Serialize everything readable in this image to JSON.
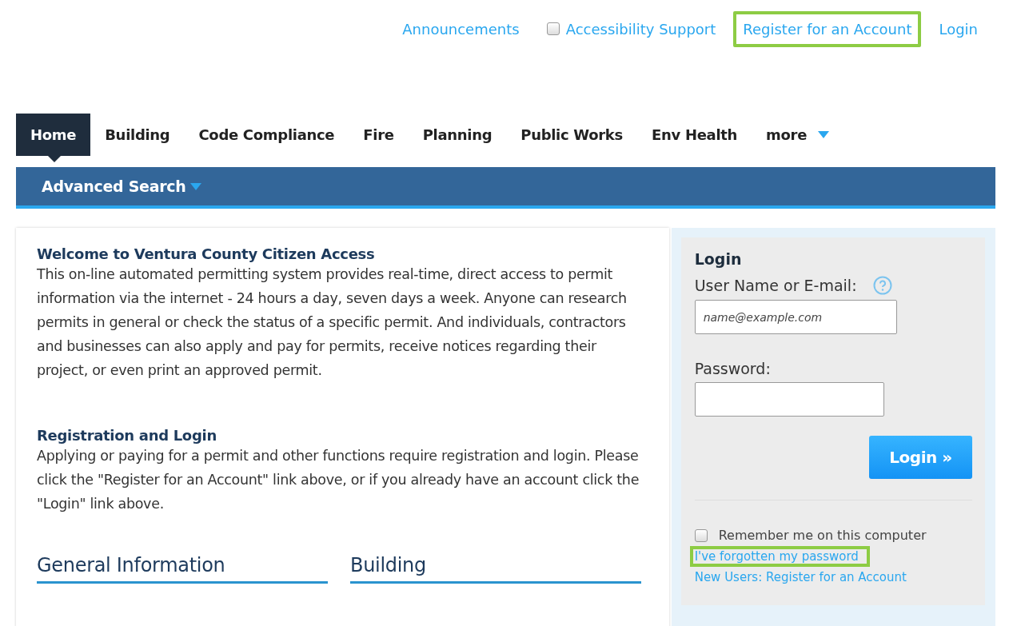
{
  "top_links": [
    {
      "kind": "link",
      "label": "Announcements",
      "highlighted": false
    },
    {
      "kind": "checkbox",
      "label": "Accessibility Support",
      "checked": false,
      "highlighted": false
    },
    {
      "kind": "link",
      "label": "Register for an Account",
      "highlighted": true
    },
    {
      "kind": "link",
      "label": "Login",
      "highlighted": false
    }
  ],
  "tabs": [
    {
      "label": "Home",
      "selected": true
    },
    {
      "label": "Building",
      "selected": false
    },
    {
      "label": "Code Compliance",
      "selected": false
    },
    {
      "label": "Fire",
      "selected": false
    },
    {
      "label": "Planning",
      "selected": false
    },
    {
      "label": "Public Works",
      "selected": false
    },
    {
      "label": "Env Health",
      "selected": false
    },
    {
      "label": "more",
      "selected": false,
      "dropdown": true
    }
  ],
  "subnav": {
    "label": "Advanced Search"
  },
  "intro": [
    {
      "heading": "Welcome to Ventura County Citizen Access",
      "text": "This on-line automated permitting system provides real-time, direct access to permit information via the internet - 24 hours a day, seven days a week. Anyone can research permits in general or check the status of a specific permit.  And individuals, contractors and businesses can also apply and pay for permits, receive notices regarding their project, or even print an approved permit."
    },
    {
      "heading": "Registration and Login",
      "text": "Applying or paying for a permit and other functions require registration and login.  Please click the \"Register for an Account\" link above, or if you already have an account click the \"Login\" link above."
    }
  ],
  "sections": [
    "General Information",
    "Building"
  ],
  "login": {
    "title": "Login",
    "username_label": "User Name or E-mail:",
    "username_placeholder": "name@example.com",
    "password_label": "Password:",
    "button": "Login »",
    "remember": {
      "label": "Remember me on this computer",
      "checked": false
    },
    "links": [
      {
        "label": "I've forgotten my password",
        "highlighted": true
      },
      {
        "label": "New Users: Register for an Account",
        "highlighted": false
      }
    ]
  }
}
